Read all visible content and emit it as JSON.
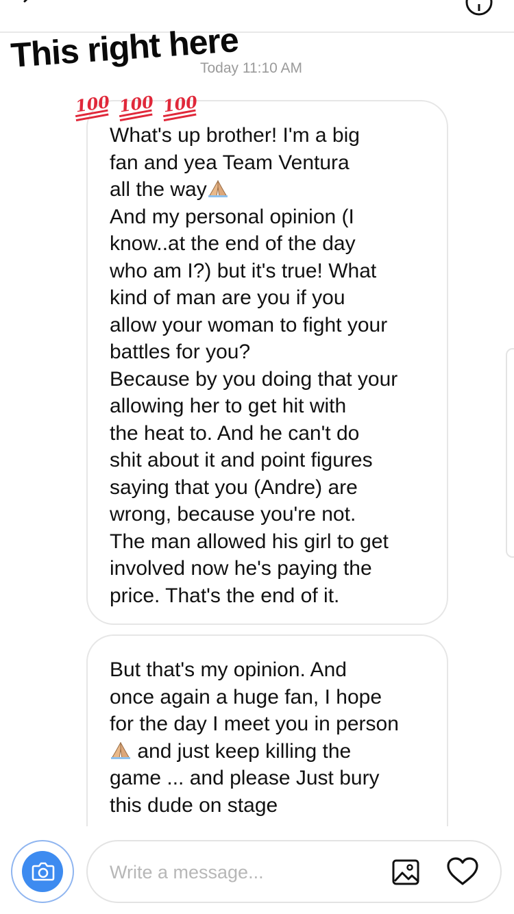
{
  "header": {
    "back_icon": "chevron-left-icon",
    "info_icon": "info-circle-icon"
  },
  "overlay": {
    "caption": "This right here",
    "emojis": [
      "100-emoji",
      "100-emoji",
      "100-emoji"
    ]
  },
  "thread": {
    "timestamp": "Today 11:10 AM",
    "messages": [
      {
        "lines": [
          "What's up brother! I'm a big",
          "fan and yea Team Ventura",
          "all the way",
          "And my personal opinion (I",
          "know..at the end of the day",
          "who am I?) but it's true! What",
          "kind of man are you if you",
          "allow your woman to fight your",
          "battles for you?",
          "Because by you doing that your",
          "allowing her to get hit with",
          "the heat to. And he can't do",
          "shit about it and point figures",
          "saying that you (Andre) are",
          "wrong, because you're not.",
          "The man allowed his girl to get",
          "involved now he's paying the",
          "price. That's the end of it."
        ]
      },
      {
        "lines": [
          "But that's my opinion. And",
          "once again a huge fan, I hope",
          "for the day I meet you in person",
          "and just keep killing the",
          "game ... and please Just bury",
          "this dude on stage"
        ]
      }
    ]
  },
  "composer": {
    "placeholder": "Write a message...",
    "camera_icon": "camera-icon",
    "gallery_icon": "image-gallery-icon",
    "like_icon": "heart-icon",
    "accent_color": "#3d8bf0"
  }
}
